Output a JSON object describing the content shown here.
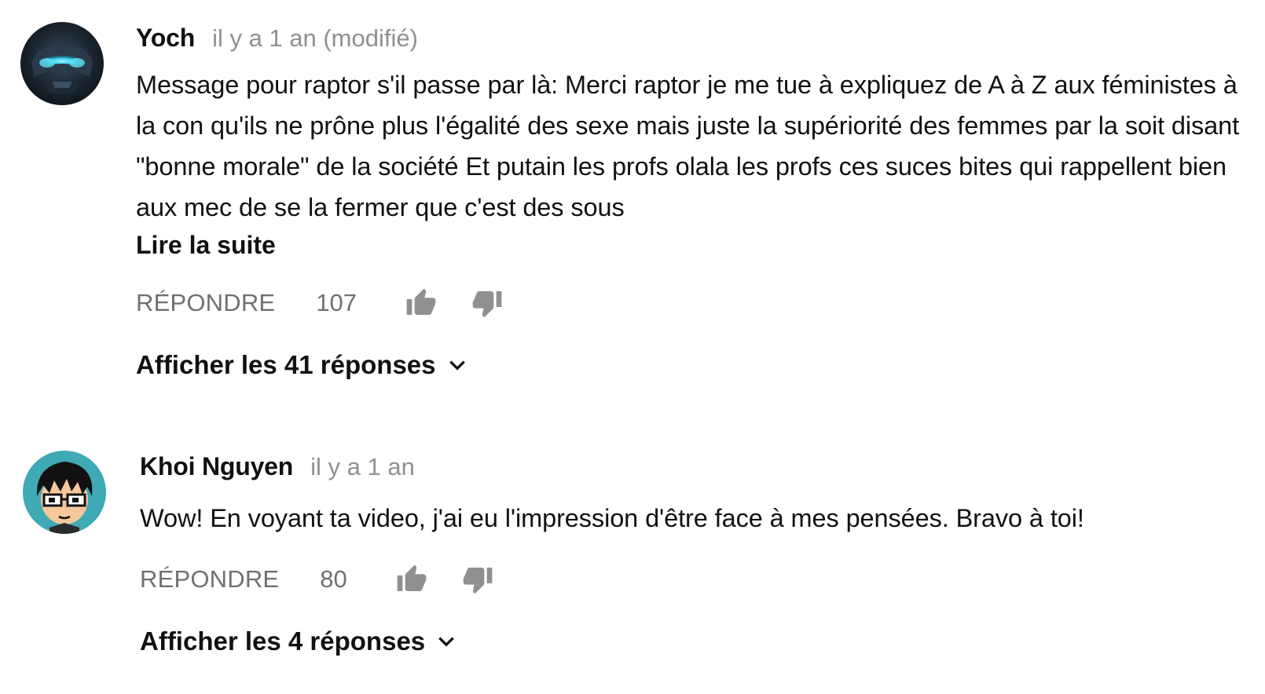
{
  "comments": [
    {
      "author": "Yoch",
      "timestamp": "il y a 1 an (modifié)",
      "text": "Message pour raptor s'il passe par là: Merci raptor je me tue à expliquez de A à Z aux féministes à la con qu'ils ne prône plus l'égalité des sexe mais juste la supériorité des femmes par la soit disant \"bonne morale\" de la société Et putain les profs olala les profs ces suces bites qui rappellent bien aux mec de se la fermer que c'est des sous",
      "read_more": "Lire la suite",
      "reply_label": "RÉPONDRE",
      "like_count": "107",
      "replies_label": "Afficher les 41 réponses",
      "avatar_icon": "robot-helmet-avatar"
    },
    {
      "author": "Khoi Nguyen",
      "timestamp": "il y a 1 an",
      "text": "Wow! En voyant ta video, j'ai eu l'impression d'être face à mes pensées. Bravo à toi!",
      "reply_label": "RÉPONDRE",
      "like_count": "80",
      "replies_label": "Afficher les 4 réponses",
      "avatar_icon": "cartoon-glasses-avatar"
    }
  ],
  "colors": {
    "text_primary": "#111111",
    "text_secondary": "#909090",
    "action_gray": "#707070",
    "avatar_teal": "#3fa9b5"
  },
  "icons": {
    "like": "thumbs-up-icon",
    "dislike": "thumbs-down-icon",
    "expand": "chevron-down-icon"
  }
}
